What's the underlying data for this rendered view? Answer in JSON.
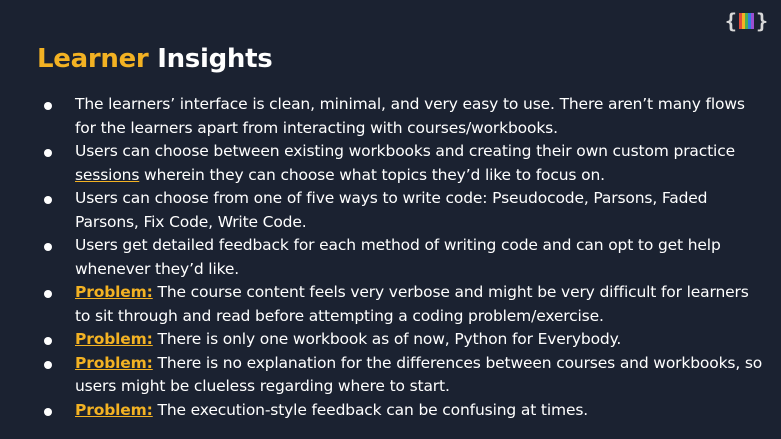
{
  "logo": {
    "open_brace": "{",
    "close_brace": "}",
    "bar_colors": [
      "#e04a3a",
      "#f3b223",
      "#4caf50",
      "#2f7de1",
      "#9b4fd1"
    ]
  },
  "title": {
    "highlight": "Learner",
    "rest": "Insights"
  },
  "accent_color": "#f3b223",
  "bullets": [
    {
      "text": "The learners’ interface is clean, minimal, and very easy to use. There aren’t many flows for the learners apart from interacting with courses/workbooks."
    },
    {
      "text_before": "Users can choose between existing workbooks and creating their own custom practice ",
      "underlined": "sessions",
      "text_after": " wherein they can choose what topics they’d like to focus on."
    },
    {
      "text": "Users can choose from one of five ways to write code: Pseudocode, Parsons, Faded Parsons, Fix Code, Write Code."
    },
    {
      "text": "Users get detailed feedback for each method of writing code and can opt to get help whenever they’d like."
    },
    {
      "label": "Problem:",
      "text": " The course content feels very verbose and might be very difficult for learners to sit through and read before attempting a coding problem/exercise."
    },
    {
      "label": "Problem:",
      "text": " There is only one workbook as of now, Python for Everybody."
    },
    {
      "label": "Problem:",
      "text": " There is no explanation for the differences between courses and workbooks, so users might be clueless regarding where to start."
    },
    {
      "label": "Problem:",
      "text": " The execution-style feedback can be confusing at times."
    }
  ]
}
